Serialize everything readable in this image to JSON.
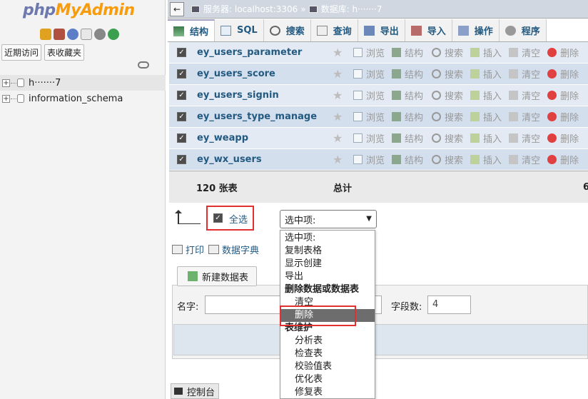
{
  "nav": {
    "logo_php": "php",
    "logo_myadmin": "MyAdmin",
    "tabs": [
      "近期访问",
      "表收藏夹"
    ],
    "databases": [
      "h·······7",
      "information_schema"
    ]
  },
  "topbar": {
    "server": "服务器: localhost:3306",
    "separator": "»",
    "database": "数据库: h·······7"
  },
  "tabs": [
    "结构",
    "SQL",
    "搜索",
    "查询",
    "导出",
    "导入",
    "操作",
    "程序"
  ],
  "tables": [
    "ey_users_parameter",
    "ey_users_score",
    "ey_users_signin",
    "ey_users_type_manage",
    "ey_weapp",
    "ey_wx_users"
  ],
  "row_actions": [
    "浏览",
    "结构",
    "搜索",
    "插入",
    "清空",
    "删除"
  ],
  "summary": {
    "count": "120 张表",
    "total": "总计",
    "number": "6"
  },
  "bulk": {
    "select_all": "全选",
    "selected_label": "选中项:"
  },
  "dropdown_items": [
    {
      "label": "选中项:",
      "kind": "plain"
    },
    {
      "label": "复制表格",
      "kind": "plain"
    },
    {
      "label": "显示创建",
      "kind": "plain"
    },
    {
      "label": "导出",
      "kind": "plain"
    },
    {
      "label": "删除数据或数据表",
      "kind": "group"
    },
    {
      "label": "清空",
      "kind": "indent"
    },
    {
      "label": "删除",
      "kind": "highlight"
    },
    {
      "label": "表维护",
      "kind": "group"
    },
    {
      "label": "分析表",
      "kind": "indent"
    },
    {
      "label": "检查表",
      "kind": "indent"
    },
    {
      "label": "校验值表",
      "kind": "indent"
    },
    {
      "label": "优化表",
      "kind": "indent"
    },
    {
      "label": "修复表",
      "kind": "indent"
    }
  ],
  "print_links": {
    "print": "打印",
    "dict": "数据字典"
  },
  "create": {
    "button": "新建数据表",
    "name_label": "名字:",
    "fields_label": "字段数:",
    "fields_value": "4"
  },
  "console": "控制台",
  "colors": {
    "accent": "#235a81",
    "highlight_box": "#e03030",
    "row_bg": "#e3eaf3",
    "row_bg_alt": "#d4dfee"
  }
}
